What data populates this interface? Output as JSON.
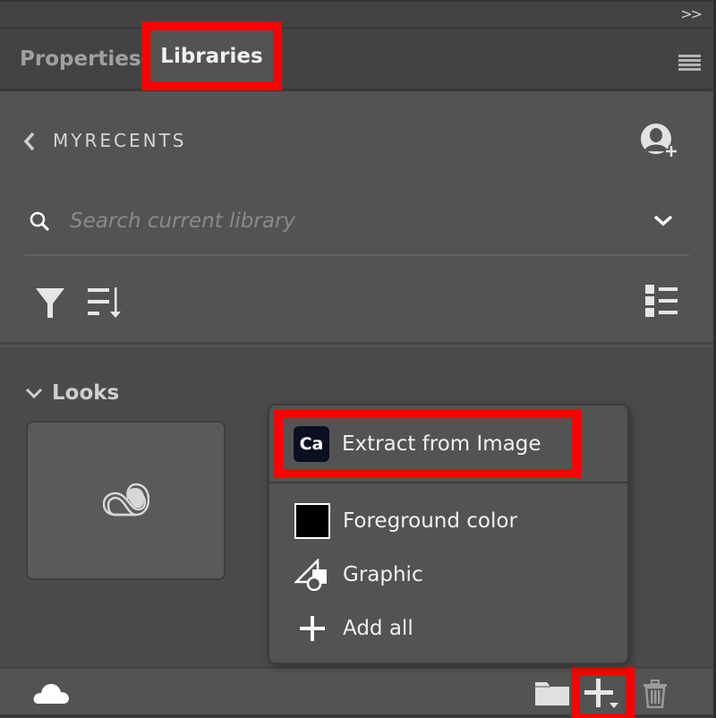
{
  "panel": {
    "collapse_label": ">>",
    "tabs": [
      {
        "label": "Properties",
        "active": false
      },
      {
        "label": "Libraries",
        "active": true
      }
    ],
    "menu_icon": "hamburger-menu-icon"
  },
  "library": {
    "back_icon": "chevron-left-icon",
    "name": "MYRECENTS",
    "add_user_icon": "add-user-icon"
  },
  "search": {
    "placeholder": "Search current library",
    "value": "",
    "icon": "search-icon",
    "dropdown_icon": "chevron-down-icon"
  },
  "toolbar": {
    "filter_icon": "filter-icon",
    "sort_icon": "sort-icon",
    "view_icon": "list-view-icon"
  },
  "groups": [
    {
      "title": "Looks",
      "expanded": true,
      "items": [
        {
          "icon": "creative-cloud-icon"
        }
      ]
    }
  ],
  "add_menu": {
    "items": [
      {
        "label": "Extract from Image",
        "icon": "capture-app-icon",
        "icon_text": "Ca",
        "highlighted": true
      },
      {
        "label": "Foreground color",
        "icon": "color-swatch-icon",
        "swatch_color": "#000000"
      },
      {
        "label": "Graphic",
        "icon": "graphic-shapes-icon"
      },
      {
        "label": "Add all",
        "icon": "plus-icon"
      }
    ]
  },
  "bottom_bar": {
    "sync_icon": "cloud-icon",
    "folder_icon": "folder-icon",
    "add_icon": "plus-dropdown-icon",
    "delete_icon": "trash-icon"
  },
  "colors": {
    "highlight": "#ff0000",
    "panel_bg": "#535353",
    "header_bg": "#434343",
    "capture_badge": "#0a1021"
  }
}
